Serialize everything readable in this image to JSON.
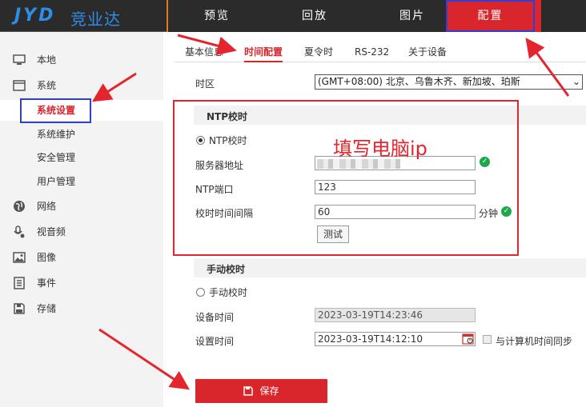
{
  "brand": {
    "logo_latin": "JYD",
    "logo_cn": "竞业达"
  },
  "nav": {
    "items": [
      "预览",
      "回放",
      "图片",
      "配置"
    ]
  },
  "sidebar": {
    "items": [
      {
        "label": "本地",
        "icon": "monitor-icon"
      },
      {
        "label": "系统",
        "icon": "system-icon"
      },
      {
        "label": "系统设置",
        "sub": true,
        "active": true
      },
      {
        "label": "系统维护",
        "sub": true
      },
      {
        "label": "安全管理",
        "sub": true
      },
      {
        "label": "用户管理",
        "sub": true
      },
      {
        "label": "网络",
        "icon": "globe-icon"
      },
      {
        "label": "视音频",
        "icon": "microphone-icon"
      },
      {
        "label": "图像",
        "icon": "image-icon"
      },
      {
        "label": "事件",
        "icon": "event-list-icon"
      },
      {
        "label": "存储",
        "icon": "floppy-disk-icon"
      }
    ]
  },
  "tabs": [
    "基本信息",
    "时间配置",
    "夏令时",
    "RS-232",
    "关于设备"
  ],
  "form": {
    "timezone_label": "时区",
    "timezone_value": "(GMT+08:00) 北京、乌鲁木齐、新加坡、珀斯",
    "ntp_section": "NTP校时",
    "ntp_radio": "NTP校时",
    "server_label": "服务器地址",
    "port_label": "NTP端口",
    "port_value": "123",
    "interval_label": "校时时间间隔",
    "interval_value": "60",
    "interval_unit": "分钟",
    "test_button": "测试",
    "manual_section": "手动校时",
    "manual_radio": "手动校时",
    "device_time_label": "设备时间",
    "device_time_value": "2023-03-19T14:23:46",
    "set_time_label": "设置时间",
    "set_time_value": "2023-03-19T14:12:10",
    "sync_label": "与计算机时间同步",
    "save_button": "保存"
  },
  "annotation": {
    "note": "填写电脑ip"
  },
  "colors": {
    "accent": "#d9262c",
    "highlight_box": "#2f3fd6",
    "annotation": "#e4252d"
  }
}
